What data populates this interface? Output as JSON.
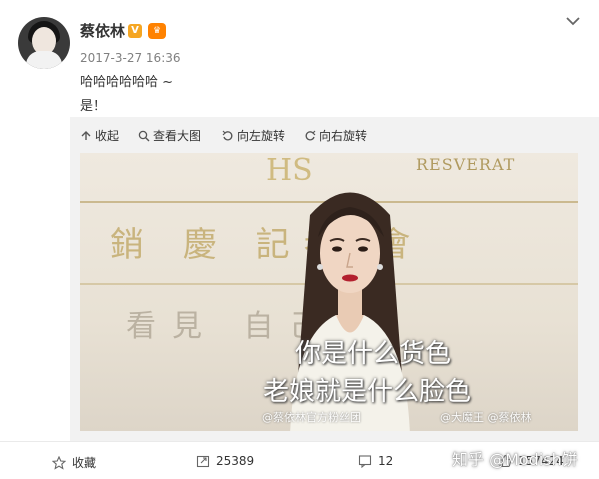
{
  "post": {
    "username": "蔡依林",
    "verified_badge": "V",
    "vip_badge": "♛",
    "timestamp": "2017-3-27 16:36",
    "text_line1": "哈哈哈哈哈哈 ~",
    "text_line2": "是！"
  },
  "toolbar": {
    "collapse_label": "收起",
    "view_large_label": "查看大图",
    "rotate_left_label": "向左旋转",
    "rotate_right_label": "向右旋转"
  },
  "image": {
    "top_banner_text": "RESVERAT",
    "backdrop_line1": "銷 慶 記者 會",
    "backdrop_line2": "看見 自己",
    "top_logo": "HS",
    "subtitle_line1": "你是什么货色",
    "subtitle_line2": "老娘就是什么脸色",
    "watermark_left": "@蔡依林官方粉丝团",
    "watermark_right": "@大魔王 @蔡依林"
  },
  "actions": {
    "favorite_label": "收藏",
    "repost_count": "25389",
    "comment_count": "12",
    "like_count": "157424"
  },
  "overlay_watermark": "知乎 @Modish饼",
  "colors": {
    "orange_badge": "#ff8200",
    "gold_badge": "#f5a623",
    "toolbar_bg": "#f2f2f2"
  }
}
